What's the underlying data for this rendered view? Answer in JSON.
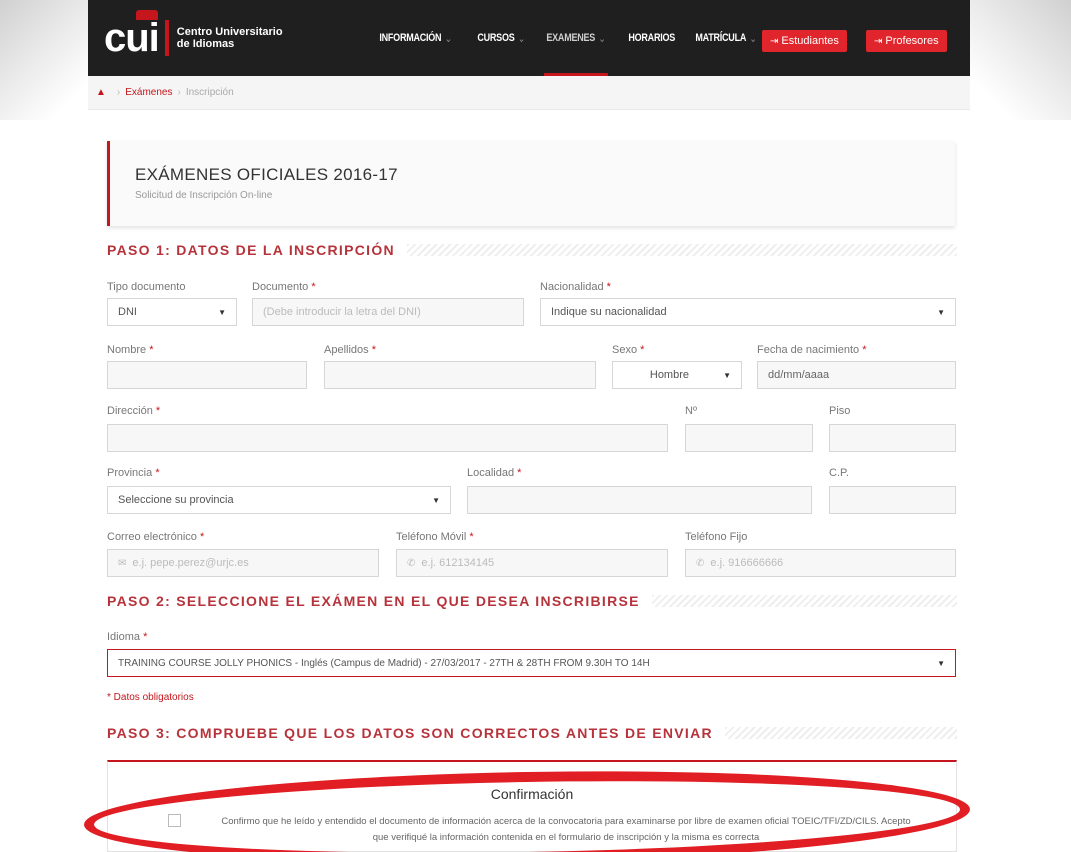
{
  "header": {
    "logo_short": "cui",
    "logo_line1": "Centro Universitario",
    "logo_line2": "de Idiomas",
    "nav": [
      {
        "label": "INFORMACIÓN",
        "caret": "⌄"
      },
      {
        "label": "CURSOS",
        "caret": "⌄"
      },
      {
        "label": "EXAMENES",
        "caret": "⌄"
      },
      {
        "label": "HORARIOS",
        "caret": ""
      },
      {
        "label": "MATRÍCULA",
        "caret": "⌄"
      }
    ],
    "btn_students": "Estudiantes",
    "btn_teachers": "Profesores"
  },
  "breadcrumb": {
    "items": [
      "Exámenes",
      "Inscripción"
    ]
  },
  "title_box": {
    "title": "EXÁMENES OFICIALES 2016-17",
    "subtitle": "Solicitud de Inscripción On-line"
  },
  "step1": {
    "title": "PASO 1: DATOS DE LA INSCRIPCIÓN",
    "tipo_documento": {
      "label": "Tipo documento",
      "value": "DNI"
    },
    "documento": {
      "label": "Documento",
      "required": "*",
      "placeholder": "(Debe introducir la letra del DNI)"
    },
    "nacionalidad": {
      "label": "Nacionalidad",
      "required": "*",
      "value": "Indique su nacionalidad"
    },
    "nombre": {
      "label": "Nombre",
      "required": "*"
    },
    "apellidos": {
      "label": "Apellidos",
      "required": "*"
    },
    "sexo": {
      "label": "Sexo",
      "required": "*",
      "value": "Hombre"
    },
    "fecha": {
      "label": "Fecha de nacimiento",
      "required": "*",
      "placeholder": "dd/mm/aaaa"
    },
    "direccion": {
      "label": "Dirección",
      "required": "*"
    },
    "numero": {
      "label": "Nº"
    },
    "piso": {
      "label": "Piso"
    },
    "provincia": {
      "label": "Provincia",
      "required": "*",
      "value": "Seleccione su provincia"
    },
    "localidad": {
      "label": "Localidad",
      "required": "*"
    },
    "cp": {
      "label": "C.P."
    },
    "correo": {
      "label": "Correo electrónico",
      "required": "*",
      "placeholder": "e.j. pepe.perez@urjc.es"
    },
    "movil": {
      "label": "Teléfono Móvil",
      "required": "*",
      "placeholder": "e.j. 612134145"
    },
    "fijo": {
      "label": "Teléfono Fijo",
      "placeholder": "e.j. 916666666"
    }
  },
  "step2": {
    "title": "PASO 2: SELECCIONE EL EXÁMEN EN EL QUE DESEA INSCRIBIRSE",
    "idioma": {
      "label": "Idioma",
      "required": "*",
      "value": "TRAINING COURSE JOLLY PHONICS - Inglés (Campus de Madrid) - 27/03/2017 - 27TH & 28TH FROM 9.30H TO 14H"
    }
  },
  "required_note": "* Datos obligatorios",
  "step3": {
    "title": "PASO 3: COMPRUEBE QUE LOS DATOS SON CORRECTOS ANTES DE ENVIAR"
  },
  "confirmation": {
    "title": "Confirmación",
    "text": "Confirmo que he leído y entendido el documento de información acerca de la convocatoria para examinarse por libre de examen oficial TOEIC/TFI/ZD/CILS. Acepto que verifiqué la información contenida en el formulario de inscripción y la misma es correcta"
  },
  "colors": {
    "accent": "#c4161c",
    "header_bg": "#1f1f1f",
    "annotation": "#e01e24"
  }
}
